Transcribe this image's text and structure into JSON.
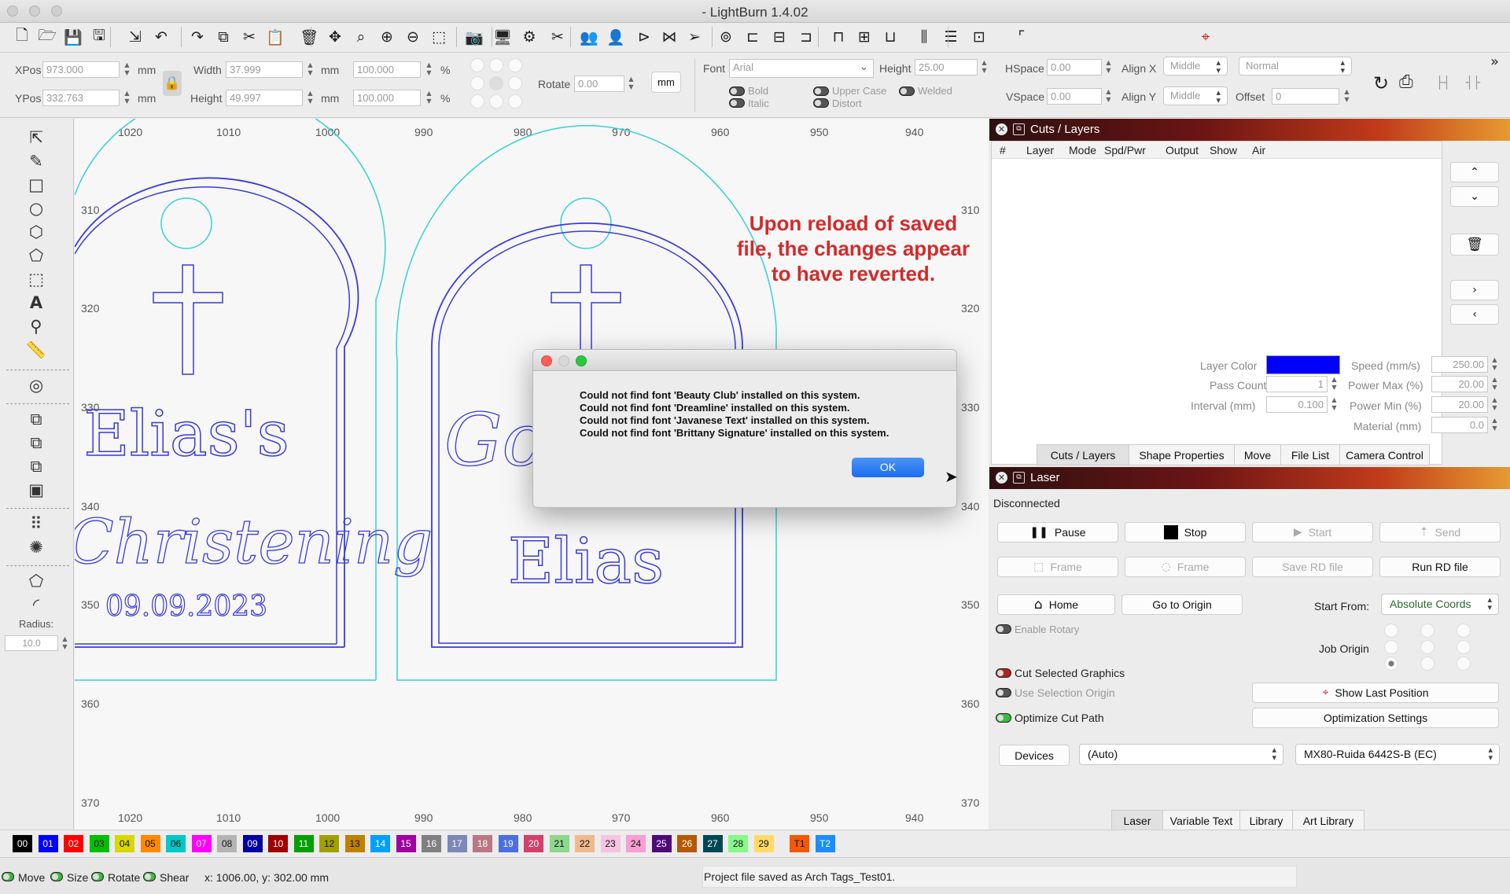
{
  "window": {
    "title": "- LightBurn 1.4.02"
  },
  "icons": {
    "toolbar": [
      "new-file-icon",
      "open-folder-icon",
      "save-icon",
      "save-as-icon",
      "import-icon",
      "undo-icon",
      "redo-icon",
      "copy-icon",
      "cut-icon",
      "paste-icon",
      "delete-icon",
      "move-icon",
      "zoom-fit-icon",
      "zoom-in-icon",
      "zoom-out-icon",
      "zoom-selection-icon",
      "camera-icon",
      "monitor-icon",
      "settings-icon",
      "tools-icon",
      "group-icon",
      "user-icon",
      "mirror-h-icon",
      "mirror-v-icon",
      "send-icon",
      "target-icon",
      "align-left-icon",
      "align-center-icon",
      "align-right-icon",
      "align-top-icon",
      "align-middle-icon",
      "align-bottom-icon",
      "distribute-h-icon",
      "distribute-v-icon",
      "move-together-icon",
      "dock-icon",
      "crosshair-icon"
    ]
  },
  "props": {
    "xpos_label": "XPos",
    "xpos_value": "973.000",
    "ypos_label": "YPos",
    "ypos_value": "332.763",
    "unit": "mm",
    "width_label": "Width",
    "width_value": "37.999",
    "height_label": "Height",
    "height_value": "49.997",
    "scale_w": "100.000",
    "scale_h": "100.000",
    "pct": "%",
    "rotate_label": "Rotate",
    "rotate_value": "0.00",
    "mm_button": "mm",
    "font_label": "Font",
    "font_value": "Arial",
    "font_height_label": "Height",
    "font_height_value": "25.00",
    "hspace_label": "HSpace",
    "hspace_value": "0.00",
    "vspace_label": "VSpace",
    "vspace_value": "0.00",
    "alignx_label": "Align X",
    "alignx_value": "Middle",
    "aligny_label": "Align Y",
    "aligny_value": "Middle",
    "normal_value": "Normal",
    "offset_label": "Offset",
    "offset_value": "0",
    "bold": "Bold",
    "italic": "Italic",
    "upper": "Upper Case",
    "distort": "Distort",
    "welded": "Welded"
  },
  "canvas": {
    "top_ruler": [
      "1020",
      "1010",
      "1000",
      "990",
      "980",
      "970",
      "960",
      "950",
      "940"
    ],
    "bottom_ruler": [
      "1020",
      "1010",
      "1000",
      "990",
      "980",
      "970",
      "960",
      "950",
      "940"
    ],
    "left_ruler": [
      "310",
      "320",
      "330",
      "340",
      "350",
      "360",
      "370"
    ],
    "right_ruler": [
      "310",
      "320",
      "330",
      "340",
      "350",
      "360",
      "370"
    ],
    "tag1_name": "Elias's",
    "tag1_script": "Christening",
    "tag1_date": "09.09.2023",
    "tag2_script": "Go",
    "tag2_name": "Elias",
    "annotation": [
      "Upon reload of saved",
      "file, the changes appear",
      "to have reverted."
    ]
  },
  "lefttools": {
    "radius_label": "Radius:",
    "radius_value": "10.0"
  },
  "dialog": {
    "lines": [
      "Could not find font 'Beauty Club' installed on this system.",
      "Could not find font 'Dreamline' installed on this system.",
      "Could not find font 'Javanese Text' installed on this system.",
      "Could not find font 'Brittany Signature' installed on this system."
    ],
    "ok": "OK"
  },
  "cuts": {
    "title": "Cuts / Layers",
    "columns": [
      "#",
      "Layer",
      "Mode",
      "Spd/Pwr",
      "Output",
      "Show",
      "Air"
    ],
    "layer_color_label": "Layer Color",
    "layer_color": "#0000ff",
    "pass_count_label": "Pass Count",
    "pass_count": "1",
    "interval_label": "Interval (mm)",
    "interval": "0.100",
    "speed_label": "Speed (mm/s)",
    "speed": "250.00",
    "pmax_label": "Power Max (%)",
    "pmax": "20.00",
    "pmin_label": "Power Min (%)",
    "pmin": "20.00",
    "material_label": "Material (mm)",
    "material": "0.0",
    "tabs": [
      "Cuts / Layers",
      "Shape Properties",
      "Move",
      "File List",
      "Camera Control"
    ]
  },
  "laser": {
    "title": "Laser",
    "status": "Disconnected",
    "pause": "Pause",
    "stop": "Stop",
    "start": "Start",
    "send": "Send",
    "frame1": "Frame",
    "frame2": "Frame",
    "save_rd": "Save RD file",
    "run_rd": "Run RD file",
    "home": "Home",
    "go_origin": "Go to Origin",
    "start_from_label": "Start From:",
    "start_from": "Absolute Coords",
    "enable_rotary": "Enable Rotary",
    "job_origin": "Job Origin",
    "cut_selected": "Cut Selected Graphics",
    "use_selection": "Use Selection Origin",
    "optimize": "Optimize Cut Path",
    "show_last": "Show Last Position",
    "opt_settings": "Optimization Settings",
    "devices": "Devices",
    "auto": "(Auto)",
    "device": "MX80-Ruida 6442S-B (EC)",
    "tabs": [
      "Laser",
      "Variable Text",
      "Library",
      "Art Library"
    ]
  },
  "palette": [
    {
      "l": "00",
      "c": "#000000",
      "t": "#ffffff"
    },
    {
      "l": "01",
      "c": "#0000ff",
      "t": "#ffffff"
    },
    {
      "l": "02",
      "c": "#ff0000",
      "t": "#ffffff"
    },
    {
      "l": "03",
      "c": "#00c000",
      "t": "#111111"
    },
    {
      "l": "04",
      "c": "#d8d800",
      "t": "#111111"
    },
    {
      "l": "05",
      "c": "#ff8800",
      "t": "#111111"
    },
    {
      "l": "06",
      "c": "#00c8c8",
      "t": "#111111"
    },
    {
      "l": "07",
      "c": "#ff00ff",
      "t": "#ffffff"
    },
    {
      "l": "08",
      "c": "#b4b4b4",
      "t": "#111111"
    },
    {
      "l": "09",
      "c": "#0000a0",
      "t": "#ffffff"
    },
    {
      "l": "10",
      "c": "#a00000",
      "t": "#ffffff"
    },
    {
      "l": "11",
      "c": "#00a000",
      "t": "#ffffff"
    },
    {
      "l": "12",
      "c": "#a0a000",
      "t": "#111111"
    },
    {
      "l": "13",
      "c": "#c08000",
      "t": "#111111"
    },
    {
      "l": "14",
      "c": "#00a0ff",
      "t": "#ffffff"
    },
    {
      "l": "15",
      "c": "#a000a0",
      "t": "#ffffff"
    },
    {
      "l": "16",
      "c": "#808080",
      "t": "#ffffff"
    },
    {
      "l": "17",
      "c": "#7d87b9",
      "t": "#ffffff"
    },
    {
      "l": "18",
      "c": "#bb7784",
      "t": "#ffffff"
    },
    {
      "l": "19",
      "c": "#4a6fe3",
      "t": "#ffffff"
    },
    {
      "l": "20",
      "c": "#d33f6a",
      "t": "#ffffff"
    },
    {
      "l": "21",
      "c": "#8cd78c",
      "t": "#111111"
    },
    {
      "l": "22",
      "c": "#f0b98d",
      "t": "#111111"
    },
    {
      "l": "23",
      "c": "#f6c4e1",
      "t": "#111111"
    },
    {
      "l": "24",
      "c": "#fa9ed4",
      "t": "#111111"
    },
    {
      "l": "25",
      "c": "#500a78",
      "t": "#ffffff"
    },
    {
      "l": "26",
      "c": "#b45a00",
      "t": "#ffffff"
    },
    {
      "l": "27",
      "c": "#004754",
      "t": "#ffffff"
    },
    {
      "l": "28",
      "c": "#86fa88",
      "t": "#111111"
    },
    {
      "l": "29",
      "c": "#ffdb66",
      "t": "#111111"
    },
    {
      "l": "T1",
      "c": "#f35a00",
      "t": "#111111"
    },
    {
      "l": "T2",
      "c": "#1a8cff",
      "t": "#ffffff"
    }
  ],
  "status": {
    "move": "Move",
    "size": "Size",
    "rotate": "Rotate",
    "shear": "Shear",
    "coords": "x: 1006.00, y: 302.00 mm",
    "message": "Project file saved as Arch Tags_Test01."
  }
}
